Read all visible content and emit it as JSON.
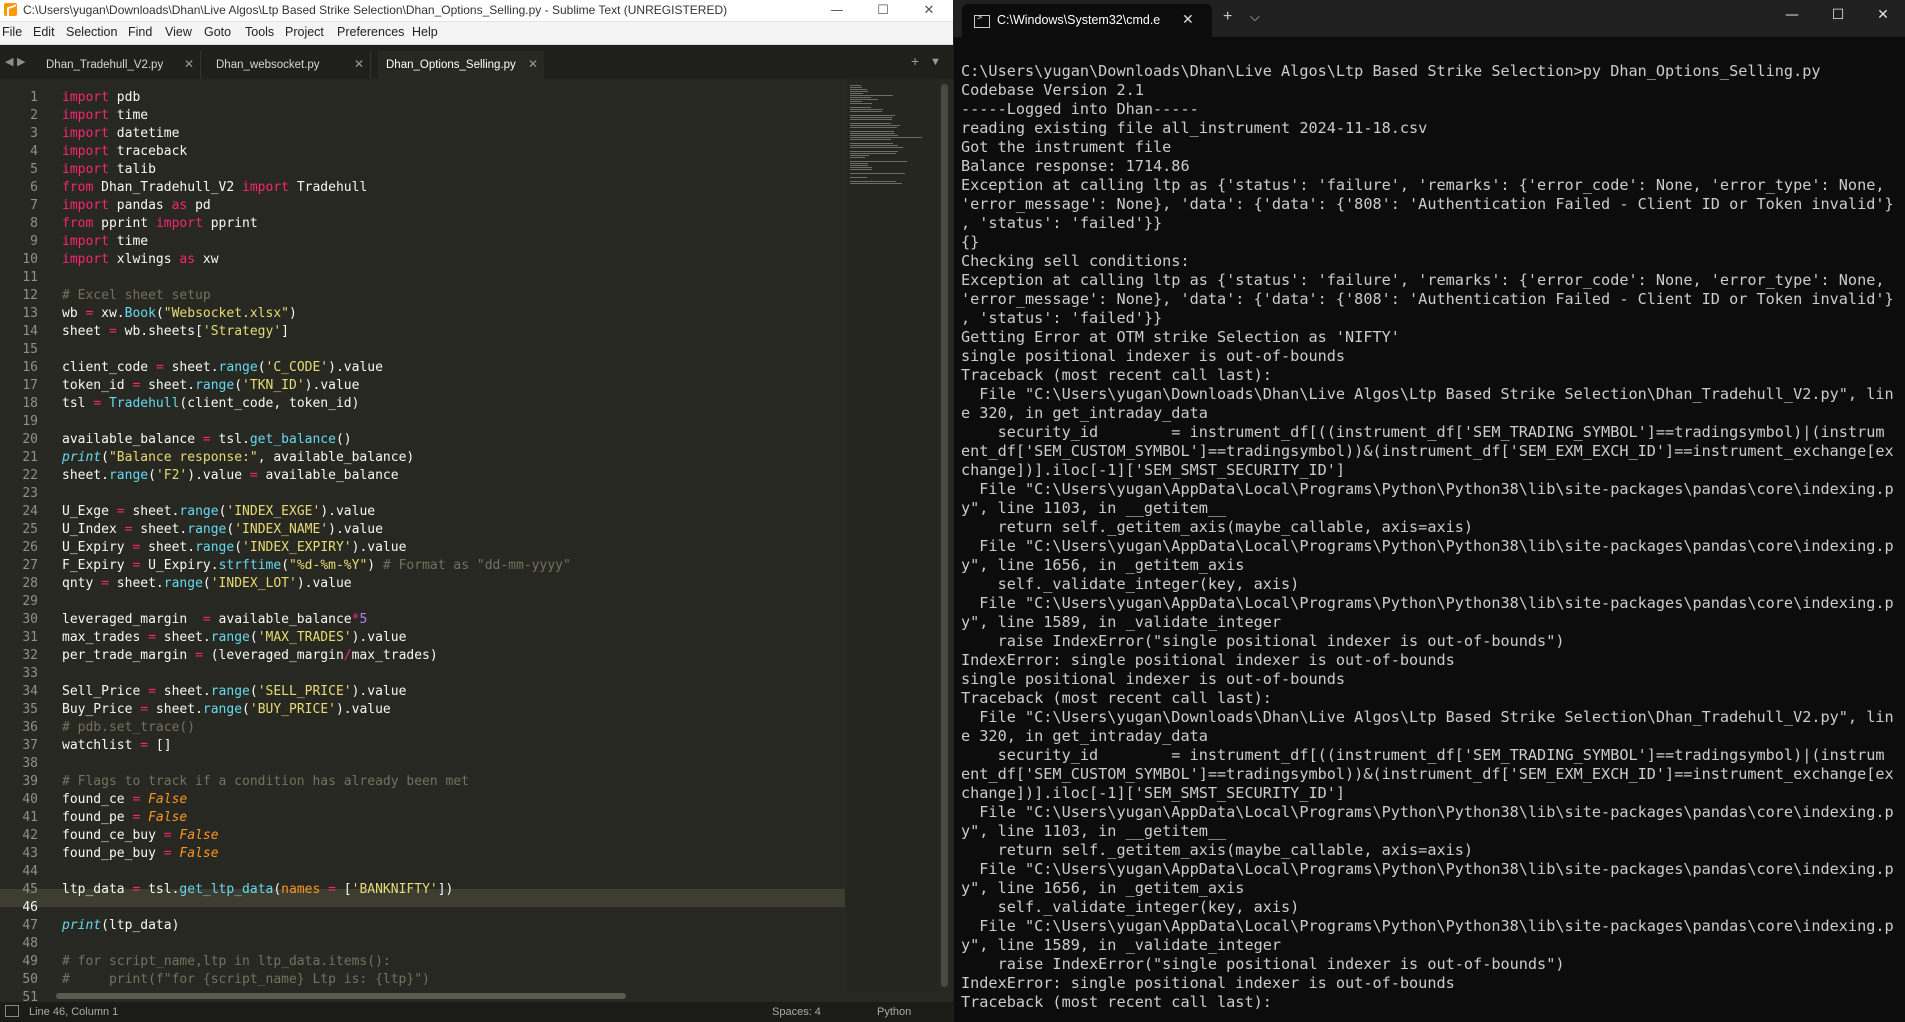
{
  "sublime": {
    "title": "C:\\Users\\yugan\\Downloads\\Dhan\\Live Algos\\Ltp Based Strike Selection\\Dhan_Options_Selling.py - Sublime Text (UNREGISTERED)",
    "window_controls": [
      "—",
      "☐",
      "✕"
    ],
    "menu": [
      "File",
      "Edit",
      "Selection",
      "Find",
      "View",
      "Goto",
      "Tools",
      "Project",
      "Preferences",
      "Help"
    ],
    "tabs": [
      {
        "label": "Dhan_Tradehull_V2.py",
        "active": false
      },
      {
        "label": "Dhan_websocket.py",
        "active": false
      },
      {
        "label": "Dhan_Options_Selling.py",
        "active": true
      }
    ],
    "tab_close": "✕",
    "nav_left": "◀",
    "nav_right": "▶",
    "new_tab": "+",
    "tab_menu": "▼",
    "current_line": 46,
    "code": [
      [
        [
          "kw",
          "import"
        ],
        [
          "pl",
          " pdb"
        ]
      ],
      [
        [
          "kw",
          "import"
        ],
        [
          "pl",
          " time"
        ]
      ],
      [
        [
          "kw",
          "import"
        ],
        [
          "pl",
          " datetime"
        ]
      ],
      [
        [
          "kw",
          "import"
        ],
        [
          "pl",
          " traceback"
        ]
      ],
      [
        [
          "kw",
          "import"
        ],
        [
          "pl",
          " talib"
        ]
      ],
      [
        [
          "kw",
          "from"
        ],
        [
          "pl",
          " Dhan_Tradehull_V2 "
        ],
        [
          "kw",
          "import"
        ],
        [
          "pl",
          " Tradehull"
        ]
      ],
      [
        [
          "kw",
          "import"
        ],
        [
          "pl",
          " pandas "
        ],
        [
          "kw",
          "as"
        ],
        [
          "pl",
          " pd"
        ]
      ],
      [
        [
          "kw",
          "from"
        ],
        [
          "pl",
          " pprint "
        ],
        [
          "kw",
          "import"
        ],
        [
          "pl",
          " pprint"
        ]
      ],
      [
        [
          "kw",
          "import"
        ],
        [
          "pl",
          " time"
        ]
      ],
      [
        [
          "kw",
          "import"
        ],
        [
          "pl",
          " xlwings "
        ],
        [
          "kw",
          "as"
        ],
        [
          "pl",
          " xw"
        ]
      ],
      [],
      [
        [
          "cm",
          "# Excel sheet setup"
        ]
      ],
      [
        [
          "pl",
          "wb "
        ],
        [
          "op",
          "="
        ],
        [
          "pl",
          " xw."
        ],
        [
          "fn",
          "Book"
        ],
        [
          "pl",
          "("
        ],
        [
          "st",
          "\"Websocket.xlsx\""
        ],
        [
          "pl",
          ")"
        ]
      ],
      [
        [
          "pl",
          "sheet "
        ],
        [
          "op",
          "="
        ],
        [
          "pl",
          " wb.sheets["
        ],
        [
          "st",
          "'Strategy'"
        ],
        [
          "pl",
          "]"
        ]
      ],
      [],
      [
        [
          "pl",
          "client_code "
        ],
        [
          "op",
          "="
        ],
        [
          "pl",
          " sheet."
        ],
        [
          "fn",
          "range"
        ],
        [
          "pl",
          "("
        ],
        [
          "st",
          "'C_CODE'"
        ],
        [
          "pl",
          ").value"
        ]
      ],
      [
        [
          "pl",
          "token_id "
        ],
        [
          "op",
          "="
        ],
        [
          "pl",
          " sheet."
        ],
        [
          "fn",
          "range"
        ],
        [
          "pl",
          "("
        ],
        [
          "st",
          "'TKN_ID'"
        ],
        [
          "pl",
          ").value"
        ]
      ],
      [
        [
          "pl",
          "tsl "
        ],
        [
          "op",
          "="
        ],
        [
          "pl",
          " "
        ],
        [
          "fn",
          "Tradehull"
        ],
        [
          "pl",
          "(client_code, token_id)"
        ]
      ],
      [],
      [
        [
          "pl",
          "available_balance "
        ],
        [
          "op",
          "="
        ],
        [
          "pl",
          " tsl."
        ],
        [
          "fn",
          "get_balance"
        ],
        [
          "pl",
          "()"
        ]
      ],
      [
        [
          "ci",
          "print"
        ],
        [
          "pl",
          "("
        ],
        [
          "st",
          "\"Balance response:\""
        ],
        [
          "pl",
          ", available_balance)"
        ]
      ],
      [
        [
          "pl",
          "sheet."
        ],
        [
          "fn",
          "range"
        ],
        [
          "pl",
          "("
        ],
        [
          "st",
          "'F2'"
        ],
        [
          "pl",
          ").value "
        ],
        [
          "op",
          "="
        ],
        [
          "pl",
          " available_balance"
        ]
      ],
      [],
      [
        [
          "pl",
          "U_Exge "
        ],
        [
          "op",
          "="
        ],
        [
          "pl",
          " sheet."
        ],
        [
          "fn",
          "range"
        ],
        [
          "pl",
          "("
        ],
        [
          "st",
          "'INDEX_EXGE'"
        ],
        [
          "pl",
          ").value"
        ]
      ],
      [
        [
          "pl",
          "U_Index "
        ],
        [
          "op",
          "="
        ],
        [
          "pl",
          " sheet."
        ],
        [
          "fn",
          "range"
        ],
        [
          "pl",
          "("
        ],
        [
          "st",
          "'INDEX_NAME'"
        ],
        [
          "pl",
          ").value"
        ]
      ],
      [
        [
          "pl",
          "U_Expiry "
        ],
        [
          "op",
          "="
        ],
        [
          "pl",
          " sheet."
        ],
        [
          "fn",
          "range"
        ],
        [
          "pl",
          "("
        ],
        [
          "st",
          "'INDEX_EXPIRY'"
        ],
        [
          "pl",
          ").value"
        ]
      ],
      [
        [
          "pl",
          "F_Expiry "
        ],
        [
          "op",
          "="
        ],
        [
          "pl",
          " U_Expiry."
        ],
        [
          "fn",
          "strftime"
        ],
        [
          "pl",
          "("
        ],
        [
          "st",
          "\"%d-%m-%Y\""
        ],
        [
          "pl",
          ") "
        ],
        [
          "cm",
          "# Format as \"dd-mm-yyyy\""
        ]
      ],
      [
        [
          "pl",
          "qnty "
        ],
        [
          "op",
          "="
        ],
        [
          "pl",
          " sheet."
        ],
        [
          "fn",
          "range"
        ],
        [
          "pl",
          "("
        ],
        [
          "st",
          "'INDEX_LOT'"
        ],
        [
          "pl",
          ").value"
        ]
      ],
      [],
      [
        [
          "pl",
          "leveraged_margin  "
        ],
        [
          "op",
          "="
        ],
        [
          "pl",
          " available_balance"
        ],
        [
          "op",
          "*"
        ],
        [
          "nu",
          "5"
        ]
      ],
      [
        [
          "pl",
          "max_trades "
        ],
        [
          "op",
          "="
        ],
        [
          "pl",
          " sheet."
        ],
        [
          "fn",
          "range"
        ],
        [
          "pl",
          "("
        ],
        [
          "st",
          "'MAX_TRADES'"
        ],
        [
          "pl",
          ").value"
        ]
      ],
      [
        [
          "pl",
          "per_trade_margin "
        ],
        [
          "op",
          "="
        ],
        [
          "pl",
          " (leveraged_margin"
        ],
        [
          "op",
          "/"
        ],
        [
          "pl",
          "max_trades)"
        ]
      ],
      [],
      [
        [
          "pl",
          "Sell_Price "
        ],
        [
          "op",
          "="
        ],
        [
          "pl",
          " sheet."
        ],
        [
          "fn",
          "range"
        ],
        [
          "pl",
          "("
        ],
        [
          "st",
          "'SELL_PRICE'"
        ],
        [
          "pl",
          ").value"
        ]
      ],
      [
        [
          "pl",
          "Buy_Price "
        ],
        [
          "op",
          "="
        ],
        [
          "pl",
          " sheet."
        ],
        [
          "fn",
          "range"
        ],
        [
          "pl",
          "("
        ],
        [
          "st",
          "'BUY_PRICE'"
        ],
        [
          "pl",
          ").value"
        ]
      ],
      [
        [
          "cm",
          "# pdb.set_trace()"
        ]
      ],
      [
        [
          "pl",
          "watchlist "
        ],
        [
          "op",
          "="
        ],
        [
          "pl",
          " []"
        ]
      ],
      [],
      [
        [
          "cm",
          "# Flags to track if a condition has already been met"
        ]
      ],
      [
        [
          "pl",
          "found_ce "
        ],
        [
          "op",
          "="
        ],
        [
          "pl",
          " "
        ],
        [
          "it",
          "False"
        ]
      ],
      [
        [
          "pl",
          "found_pe "
        ],
        [
          "op",
          "="
        ],
        [
          "pl",
          " "
        ],
        [
          "it",
          "False"
        ]
      ],
      [
        [
          "pl",
          "found_ce_buy "
        ],
        [
          "op",
          "="
        ],
        [
          "pl",
          " "
        ],
        [
          "it",
          "False"
        ]
      ],
      [
        [
          "pl",
          "found_pe_buy "
        ],
        [
          "op",
          "="
        ],
        [
          "pl",
          " "
        ],
        [
          "it",
          "False"
        ]
      ],
      [],
      [
        [
          "pl",
          "ltp_data "
        ],
        [
          "op",
          "="
        ],
        [
          "pl",
          " tsl."
        ],
        [
          "fn",
          "get_ltp_data"
        ],
        [
          "pl",
          "("
        ],
        [
          "pm",
          "names"
        ],
        [
          "pl",
          " "
        ],
        [
          "op",
          "="
        ],
        [
          "pl",
          " ["
        ],
        [
          "st",
          "'BANKNIFTY'"
        ],
        [
          "pl",
          "])"
        ]
      ],
      [],
      [
        [
          "ci",
          "print"
        ],
        [
          "pl",
          "(ltp_data)"
        ]
      ],
      [],
      [
        [
          "cm",
          "# for script_name,ltp in ltp_data.items():"
        ]
      ],
      [
        [
          "cm",
          "#     print(f\"for {script_name} Ltp is: {ltp}\")"
        ]
      ],
      []
    ],
    "status": {
      "position": "Line 46, Column 1",
      "spaces": "Spaces: 4",
      "syntax": "Python"
    }
  },
  "terminal": {
    "tab_title": "C:\\Windows\\System32\\cmd.e",
    "tab_close": "✕",
    "new_tab": "+",
    "dropdown": "⌵",
    "window_controls": [
      "—",
      "☐",
      "✕"
    ],
    "lines": [
      "C:\\Users\\yugan\\Downloads\\Dhan\\Live Algos\\Ltp Based Strike Selection>py Dhan_Options_Selling.py",
      "Codebase Version 2.1",
      "-----Logged into Dhan-----",
      "reading existing file all_instrument 2024-11-18.csv",
      "Got the instrument file",
      "Balance response: 1714.86",
      "Exception at calling ltp as {'status': 'failure', 'remarks': {'error_code': None, 'error_type': None,",
      "'error_message': None}, 'data': {'data': {'808': 'Authentication Failed - Client ID or Token invalid'}",
      ", 'status': 'failed'}}",
      "{}",
      "Checking sell conditions:",
      "Exception at calling ltp as {'status': 'failure', 'remarks': {'error_code': None, 'error_type': None,",
      "'error_message': None}, 'data': {'data': {'808': 'Authentication Failed - Client ID or Token invalid'}",
      ", 'status': 'failed'}}",
      "Getting Error at OTM strike Selection as 'NIFTY'",
      "single positional indexer is out-of-bounds",
      "Traceback (most recent call last):",
      "  File \"C:\\Users\\yugan\\Downloads\\Dhan\\Live Algos\\Ltp Based Strike Selection\\Dhan_Tradehull_V2.py\", lin",
      "e 320, in get_intraday_data",
      "    security_id        = instrument_df[((instrument_df['SEM_TRADING_SYMBOL']==tradingsymbol)|(instrum",
      "ent_df['SEM_CUSTOM_SYMBOL']==tradingsymbol))&(instrument_df['SEM_EXM_EXCH_ID']==instrument_exchange[ex",
      "change])].iloc[-1]['SEM_SMST_SECURITY_ID']",
      "  File \"C:\\Users\\yugan\\AppData\\Local\\Programs\\Python\\Python38\\lib\\site-packages\\pandas\\core\\indexing.p",
      "y\", line 1103, in __getitem__",
      "    return self._getitem_axis(maybe_callable, axis=axis)",
      "  File \"C:\\Users\\yugan\\AppData\\Local\\Programs\\Python\\Python38\\lib\\site-packages\\pandas\\core\\indexing.p",
      "y\", line 1656, in _getitem_axis",
      "    self._validate_integer(key, axis)",
      "  File \"C:\\Users\\yugan\\AppData\\Local\\Programs\\Python\\Python38\\lib\\site-packages\\pandas\\core\\indexing.p",
      "y\", line 1589, in _validate_integer",
      "    raise IndexError(\"single positional indexer is out-of-bounds\")",
      "IndexError: single positional indexer is out-of-bounds",
      "single positional indexer is out-of-bounds",
      "Traceback (most recent call last):",
      "  File \"C:\\Users\\yugan\\Downloads\\Dhan\\Live Algos\\Ltp Based Strike Selection\\Dhan_Tradehull_V2.py\", lin",
      "e 320, in get_intraday_data",
      "    security_id        = instrument_df[((instrument_df['SEM_TRADING_SYMBOL']==tradingsymbol)|(instrum",
      "ent_df['SEM_CUSTOM_SYMBOL']==tradingsymbol))&(instrument_df['SEM_EXM_EXCH_ID']==instrument_exchange[ex",
      "change])].iloc[-1]['SEM_SMST_SECURITY_ID']",
      "  File \"C:\\Users\\yugan\\AppData\\Local\\Programs\\Python\\Python38\\lib\\site-packages\\pandas\\core\\indexing.p",
      "y\", line 1103, in __getitem__",
      "    return self._getitem_axis(maybe_callable, axis=axis)",
      "  File \"C:\\Users\\yugan\\AppData\\Local\\Programs\\Python\\Python38\\lib\\site-packages\\pandas\\core\\indexing.p",
      "y\", line 1656, in _getitem_axis",
      "    self._validate_integer(key, axis)",
      "  File \"C:\\Users\\yugan\\AppData\\Local\\Programs\\Python\\Python38\\lib\\site-packages\\pandas\\core\\indexing.p",
      "y\", line 1589, in _validate_integer",
      "    raise IndexError(\"single positional indexer is out-of-bounds\")",
      "IndexError: single positional indexer is out-of-bounds",
      "Traceback (most recent call last):"
    ]
  },
  "colors": {
    "editor_bg": "#272822",
    "keyword": "#f92672",
    "function": "#66d9ef",
    "string": "#e6db74",
    "comment": "#75715e",
    "constant": "#fd971f",
    "number": "#ae81ff",
    "terminal_bg": "#0c0c0c",
    "terminal_text": "#cccccc"
  }
}
